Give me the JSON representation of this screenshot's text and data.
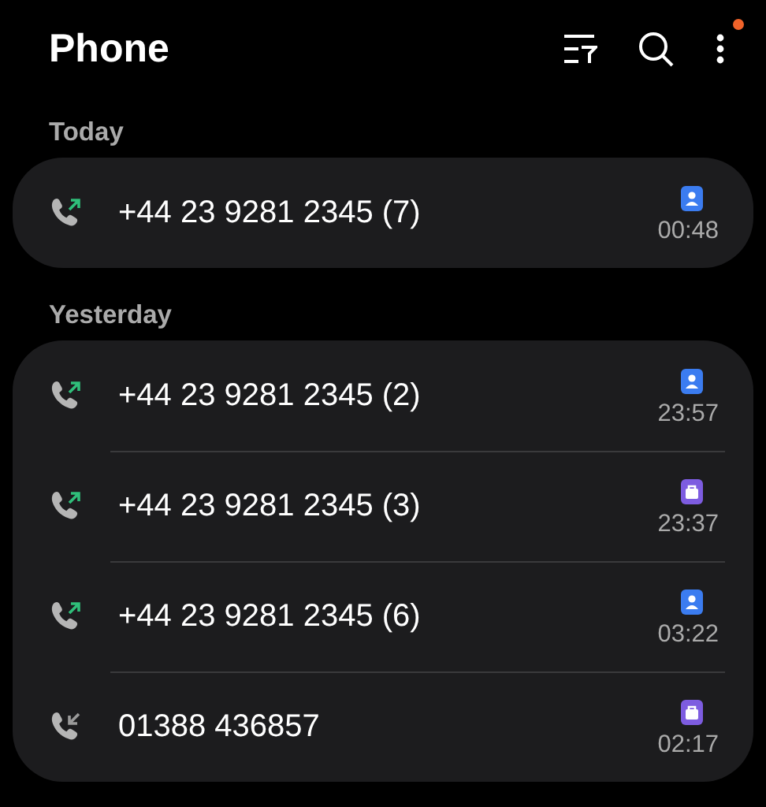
{
  "header": {
    "title": "Phone",
    "notification_dot": true
  },
  "sections": [
    {
      "label": "Today",
      "calls": [
        {
          "kind": "outgoing",
          "number": "+44 23 9281 2345 (7)",
          "badge": {
            "kind": "contact",
            "color": "#3b7cf0"
          },
          "time": "00:48"
        }
      ]
    },
    {
      "label": "Yesterday",
      "calls": [
        {
          "kind": "outgoing",
          "number": "+44 23 9281 2345 (2)",
          "badge": {
            "kind": "contact",
            "color": "#3b7cf0"
          },
          "time": "23:57"
        },
        {
          "kind": "outgoing",
          "number": "+44 23 9281 2345 (3)",
          "badge": {
            "kind": "work",
            "color": "#7d5ce0"
          },
          "time": "23:37"
        },
        {
          "kind": "outgoing",
          "number": "+44 23 9281 2345 (6)",
          "badge": {
            "kind": "contact",
            "color": "#3b7cf0"
          },
          "time": "03:22"
        },
        {
          "kind": "incoming",
          "number": "01388 436857",
          "badge": {
            "kind": "work",
            "color": "#7d5ce0"
          },
          "time": "02:17"
        }
      ]
    }
  ]
}
